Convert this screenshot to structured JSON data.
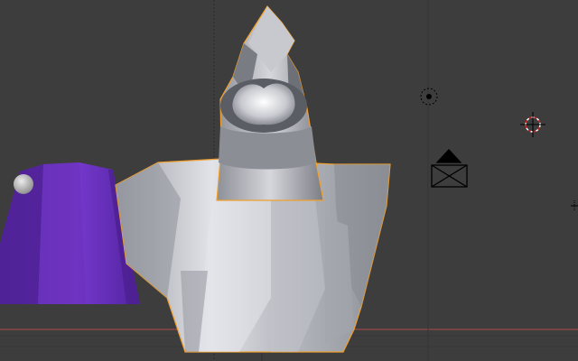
{
  "app": {
    "name": "3D viewport",
    "shading": "solid"
  },
  "colors": {
    "background": "#3d3d3d",
    "grid_line": "#353535",
    "axis_x": "#9a4a4a",
    "selection_outline": "#f0a030",
    "robe_light": "#d7d8de",
    "robe_mid": "#a6a8b0",
    "robe_dark": "#6f7078",
    "purple_light": "#7a3fcf",
    "purple_dark": "#4a1e8c",
    "pompom": "#c8c8c8",
    "widget": "#000000",
    "cursor_red": "#cc2222"
  },
  "objects": [
    {
      "name": "ghost-robe",
      "type": "mesh",
      "selected": true
    },
    {
      "name": "purple-hat",
      "type": "mesh",
      "selected": false
    },
    {
      "name": "lamp",
      "type": "light"
    },
    {
      "name": "camera",
      "type": "camera"
    },
    {
      "name": "3d-cursor",
      "type": "cursor"
    }
  ],
  "icons": [
    "lamp-icon",
    "camera-icon",
    "3d-cursor-icon"
  ]
}
